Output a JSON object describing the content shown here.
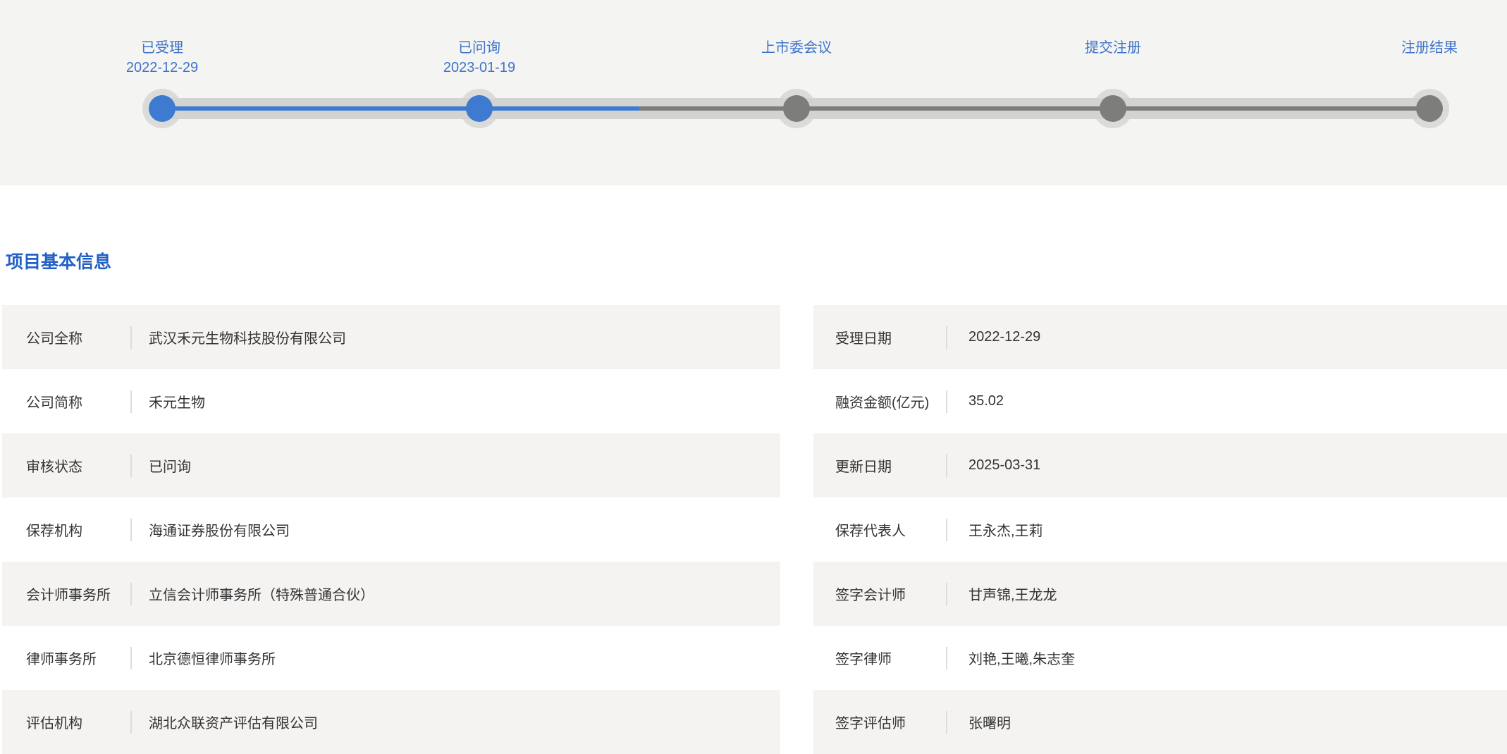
{
  "timeline": {
    "steps": [
      {
        "label": "已受理",
        "date": "2022-12-29",
        "state": "done"
      },
      {
        "label": "已问询",
        "date": "2023-01-19",
        "state": "done"
      },
      {
        "label": "上市委会议",
        "date": "",
        "state": "pending"
      },
      {
        "label": "提交注册",
        "date": "",
        "state": "pending"
      },
      {
        "label": "注册结果",
        "date": "",
        "state": "pending"
      }
    ],
    "colors": {
      "active": "#3d7ad0",
      "inactive": "#7d7d7c",
      "track": "#d3d3d2",
      "halo": "#dbdbda",
      "label_text": "#3f73c9",
      "section_bg": "#f4f4f3"
    }
  },
  "info": {
    "title": "项目基本信息",
    "title_color": "#2361c5",
    "row_stripe_color": "#f4f3f2",
    "left_rows": [
      {
        "label": "公司全称",
        "value": "武汉禾元生物科技股份有限公司"
      },
      {
        "label": "公司简称",
        "value": "禾元生物"
      },
      {
        "label": "审核状态",
        "value": "已问询"
      },
      {
        "label": "保荐机构",
        "value": "海通证券股份有限公司"
      },
      {
        "label": "会计师事务所",
        "value": "立信会计师事务所（特殊普通合伙）"
      },
      {
        "label": "律师事务所",
        "value": "北京德恒律师事务所"
      },
      {
        "label": "评估机构",
        "value": "湖北众联资产评估有限公司"
      }
    ],
    "right_rows": [
      {
        "label": "受理日期",
        "value": "2022-12-29"
      },
      {
        "label": "融资金额(亿元)",
        "value": "35.02"
      },
      {
        "label": "更新日期",
        "value": "2025-03-31"
      },
      {
        "label": "保荐代表人",
        "value": "王永杰,王莉"
      },
      {
        "label": "签字会计师",
        "value": "甘声锦,王龙龙"
      },
      {
        "label": "签字律师",
        "value": "刘艳,王曦,朱志奎"
      },
      {
        "label": "签字评估师",
        "value": "张曙明"
      }
    ]
  }
}
